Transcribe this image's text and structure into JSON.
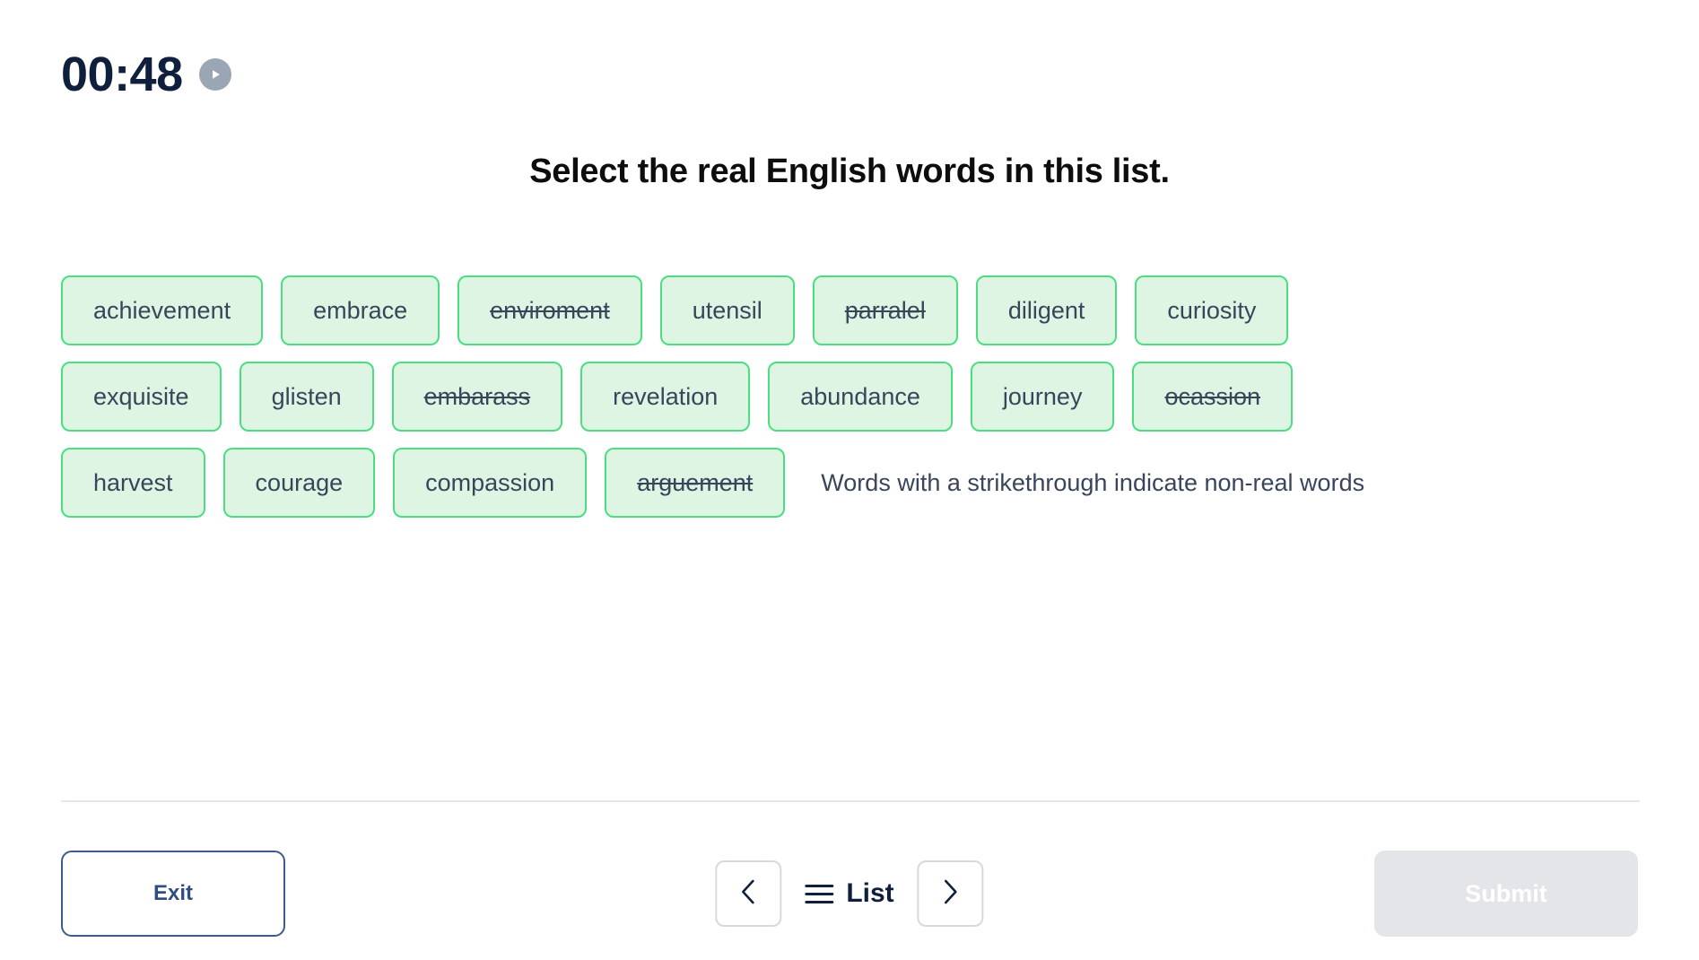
{
  "timer": {
    "value": "00:48",
    "play_icon": "play-circle-icon"
  },
  "prompt": {
    "title": "Select the real English words in this list."
  },
  "words": {
    "hint": "Words with a strikethrough indicate non-real words",
    "rows": [
      [
        {
          "text": "achievement",
          "struck": false
        },
        {
          "text": "embrace",
          "struck": false
        },
        {
          "text": "enviroment",
          "struck": true
        },
        {
          "text": "utensil",
          "struck": false
        },
        {
          "text": "parralel",
          "struck": true
        },
        {
          "text": "diligent",
          "struck": false
        },
        {
          "text": "curiosity",
          "struck": false
        }
      ],
      [
        {
          "text": "exquisite",
          "struck": false
        },
        {
          "text": "glisten",
          "struck": false
        },
        {
          "text": "embarass",
          "struck": true
        },
        {
          "text": "revelation",
          "struck": false
        },
        {
          "text": "abundance",
          "struck": false
        },
        {
          "text": "journey",
          "struck": false
        },
        {
          "text": "ocassion",
          "struck": true
        }
      ],
      [
        {
          "text": "harvest",
          "struck": false
        },
        {
          "text": "courage",
          "struck": false
        },
        {
          "text": "compassion",
          "struck": false
        },
        {
          "text": "arguement",
          "struck": true
        }
      ]
    ]
  },
  "footer": {
    "exit_label": "Exit",
    "list_label": "List",
    "prev_icon": "chevron-left-icon",
    "next_icon": "chevron-right-icon",
    "menu_icon": "hamburger-icon",
    "submit_label": "Submit",
    "submit_disabled": true
  },
  "colors": {
    "chip_fill": "#dff5e3",
    "chip_border": "#4ade80",
    "chip_text": "#39455a",
    "timer_text": "#10203c",
    "exit_border": "#3c5a8a",
    "submit_bg": "#e3e5e9"
  }
}
